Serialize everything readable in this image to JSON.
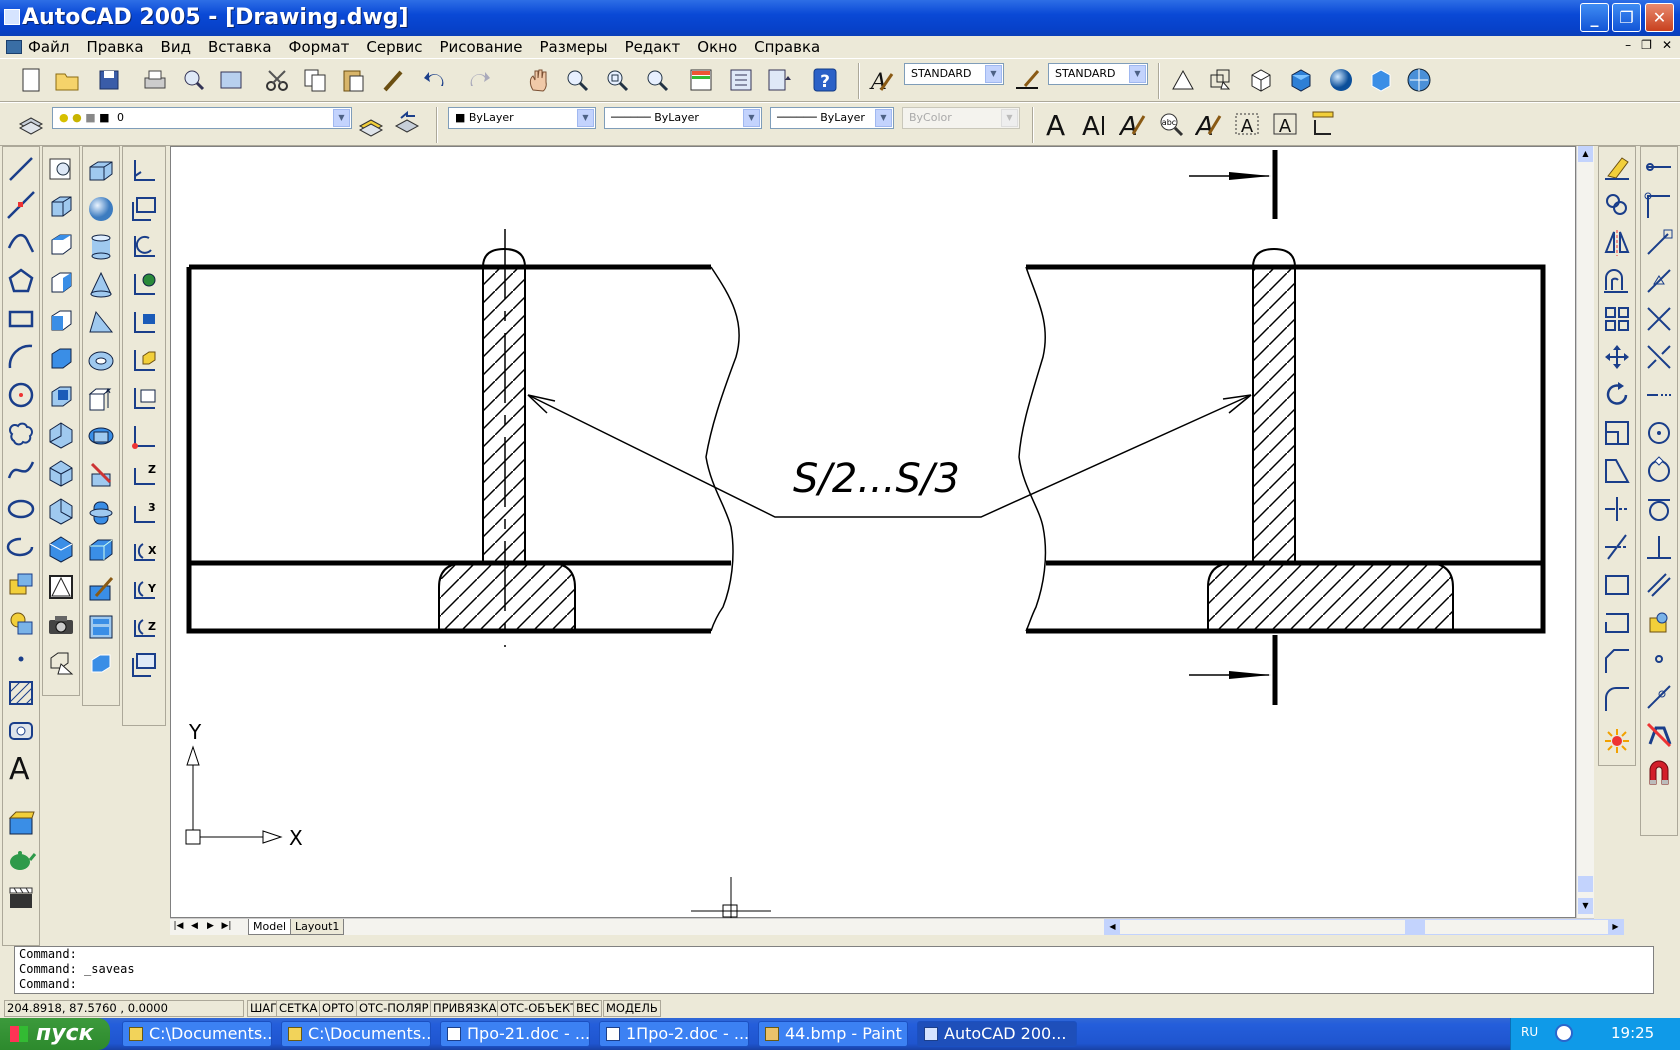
{
  "window": {
    "title": "AutoCAD 2005 - [Drawing.dwg]",
    "minimize": "_",
    "maximize": "❐",
    "close": "✕"
  },
  "menu": [
    "Файл",
    "Правка",
    "Вид",
    "Вставка",
    "Формат",
    "Сервис",
    "Рисование",
    "Размеры",
    "Редакт",
    "Окно",
    "Справка"
  ],
  "toolbar": {
    "text_style": "STANDARD",
    "dim_style": "STANDARD",
    "layer": "0",
    "color": "ByLayer",
    "linetype": "ByLayer",
    "lineweight": "ByLayer",
    "plotstyle": "ByColor"
  },
  "drawing": {
    "annotation": "S/2...S/3",
    "ucs_x": "X",
    "ucs_y": "Y"
  },
  "tabs": {
    "model": "Model",
    "layout": "Layout1"
  },
  "command": {
    "line1": "Command:",
    "line2": "Command: _saveas",
    "line3": "Command:"
  },
  "status": {
    "coords": "204.8918, 87.5760 , 0.0000",
    "buttons": [
      "ШАГ",
      "СЕТКА",
      "ОРТО",
      "ОТС-ПОЛЯР",
      "ПРИВЯЗКА",
      "ОТС-ОБЪЕКТ",
      "ВЕС",
      "МОДЕЛЬ"
    ]
  },
  "taskbar": {
    "start": "пуск",
    "tasks": [
      "C:\\Documents...",
      "C:\\Documents...",
      "Про-21.doc - ...",
      "1Про-2.doc - ...",
      "44.bmp - Paint",
      "AutoCAD 200..."
    ],
    "lang": "RU",
    "time": "19:25"
  }
}
